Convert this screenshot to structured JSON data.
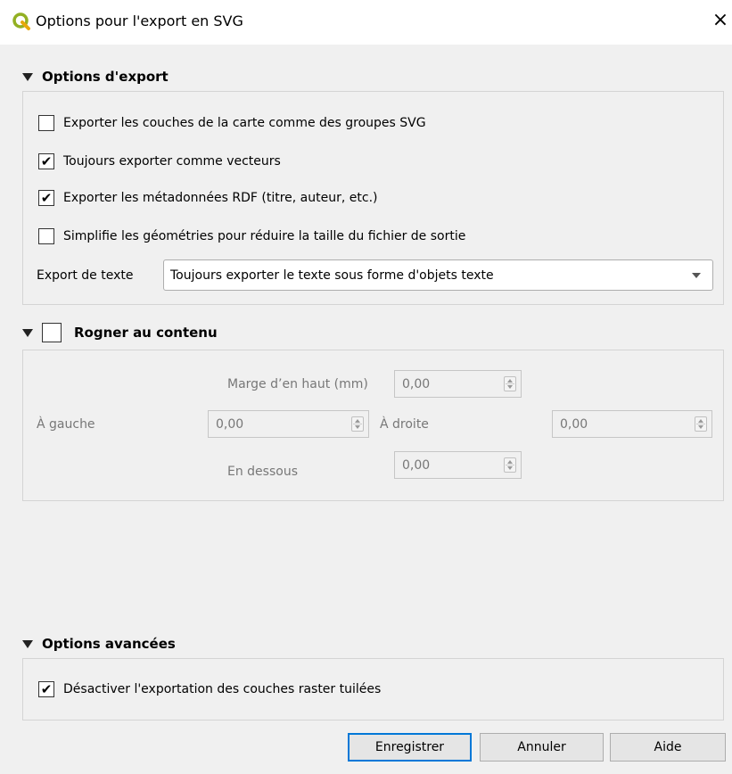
{
  "window": {
    "title": "Options pour l'export en SVG",
    "close_glyph": "×",
    "app_icon": "qgis-icon",
    "accent_color": "#93b023"
  },
  "export_options": {
    "header": "Options d'export",
    "checkboxes": [
      {
        "label": "Exporter les couches de la carte comme des groupes SVG",
        "checked": false
      },
      {
        "label": "Toujours exporter comme vecteurs",
        "checked": true
      },
      {
        "label": "Exporter les métadonnées RDF (titre, auteur, etc.)",
        "checked": true
      },
      {
        "label": "Simplifie les géométries pour réduire la taille du fichier de sortie",
        "checked": false
      }
    ],
    "text_export_label": "Export de texte",
    "text_export_value": "Toujours exporter le texte sous forme d'objets texte"
  },
  "crop": {
    "header": "Rogner au contenu",
    "checked": false,
    "top_label": "Marge d’en haut (mm)",
    "top_value": "0,00",
    "left_label": "À gauche",
    "left_value": "0,00",
    "right_label": "À droite",
    "right_value": "0,00",
    "bottom_label": "En dessous",
    "bottom_value": "0,00"
  },
  "advanced": {
    "header": "Options avancées",
    "checkbox_label": "Désactiver l'exportation des couches raster tuilées",
    "checked": true
  },
  "buttons": {
    "save": "Enregistrer",
    "cancel": "Annuler",
    "help": "Aide"
  },
  "check_glyph": "✔"
}
